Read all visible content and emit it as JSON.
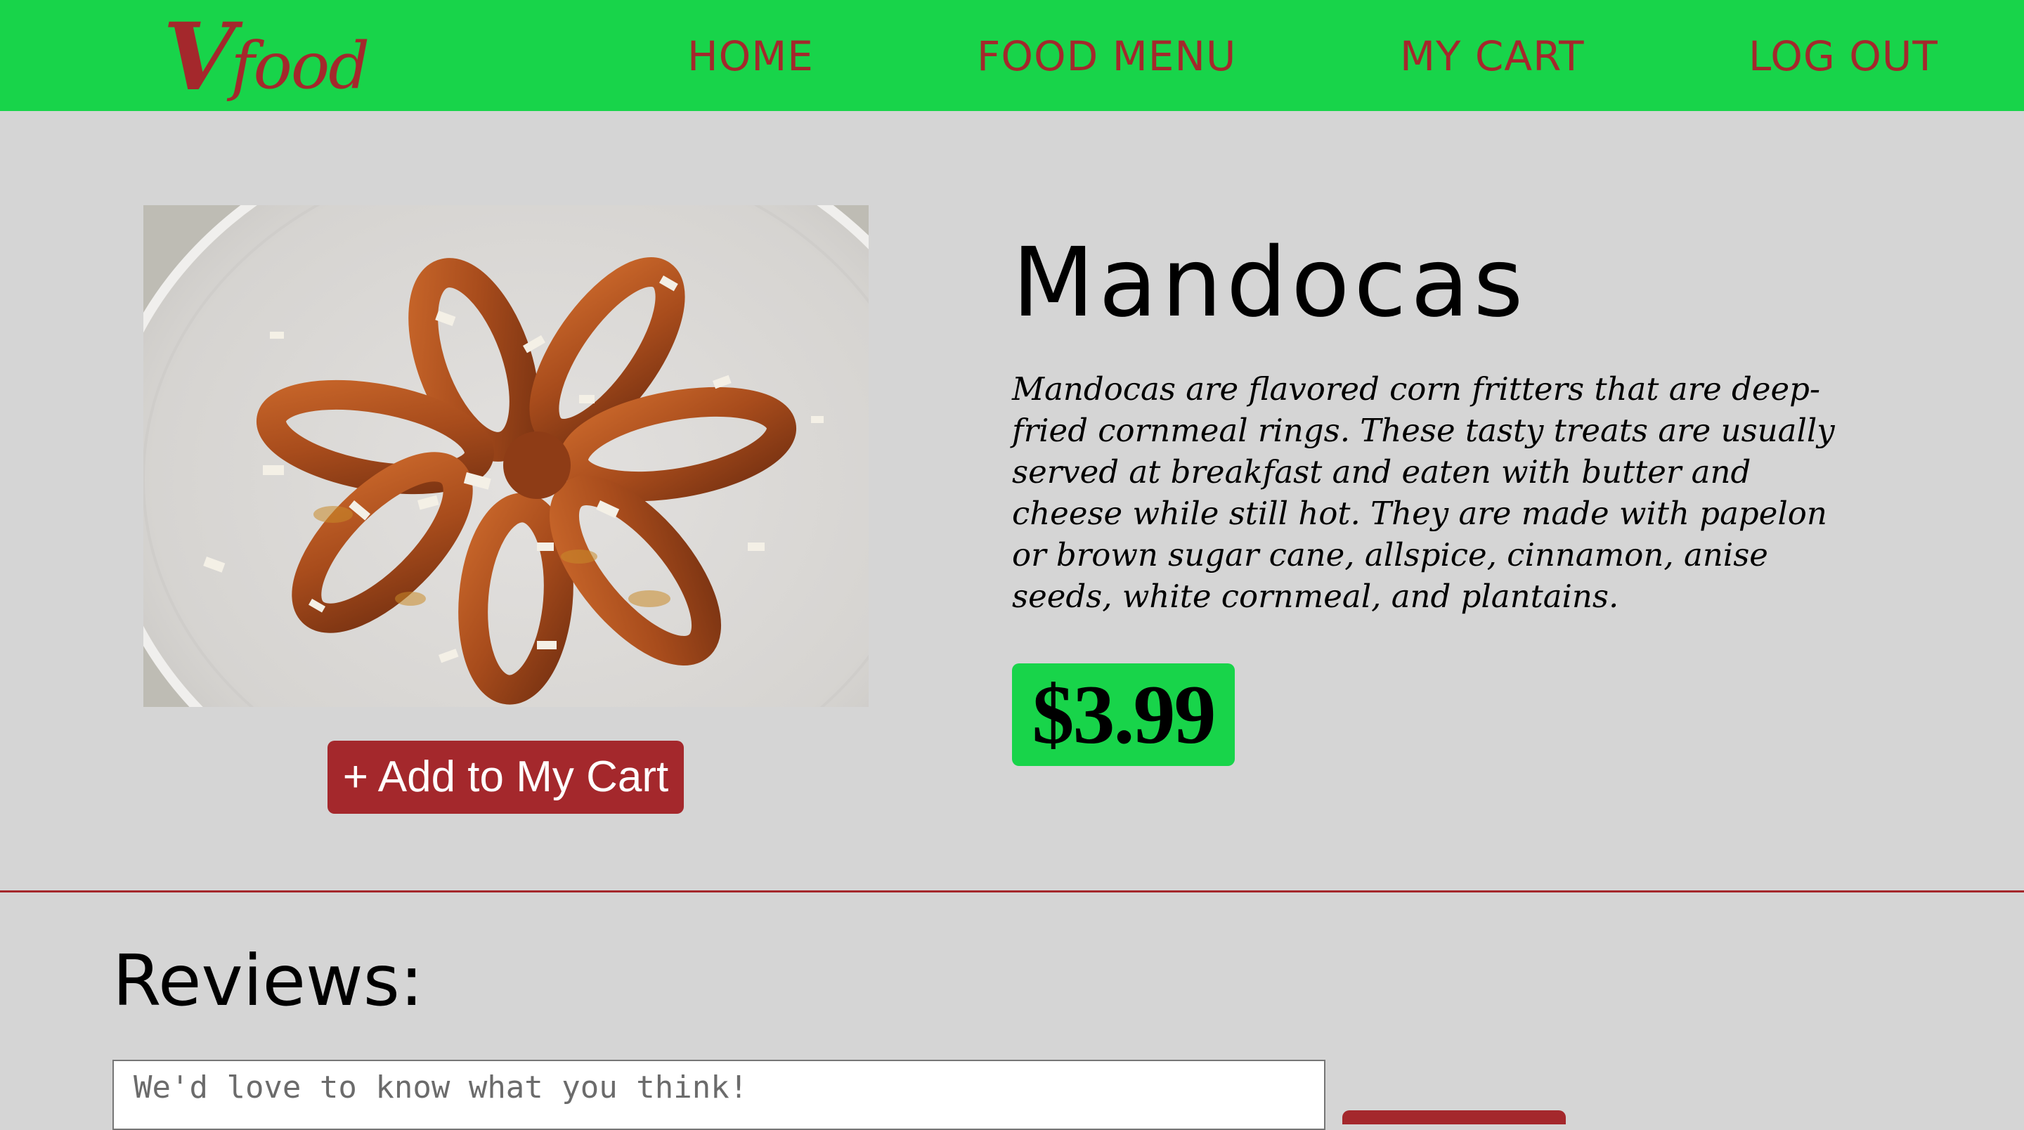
{
  "brand": {
    "logo_initial": "V",
    "logo_word": "food",
    "color_green": "#18d44a",
    "color_red": "#a4282c"
  },
  "nav": {
    "home": "HOME",
    "food_menu": "FOOD MENU",
    "my_cart": "MY CART",
    "log_out": "LOG OUT"
  },
  "product": {
    "image_icon": "fried-cornmeal-rings-photo",
    "title": "Mandocas",
    "description": "Mandocas are flavored corn fritters that are deep-fried cornmeal rings. These tasty treats are usually served at breakfast and eaten with butter and cheese while still hot. They are made with papelon or brown sugar cane, allspice, cinnamon, anise seeds, white cornmeal, and plantains.",
    "price": "$3.99",
    "add_button": "+ Add to My Cart"
  },
  "reviews": {
    "heading": "Reviews:",
    "placeholder": "We'd love to know what you think!"
  }
}
